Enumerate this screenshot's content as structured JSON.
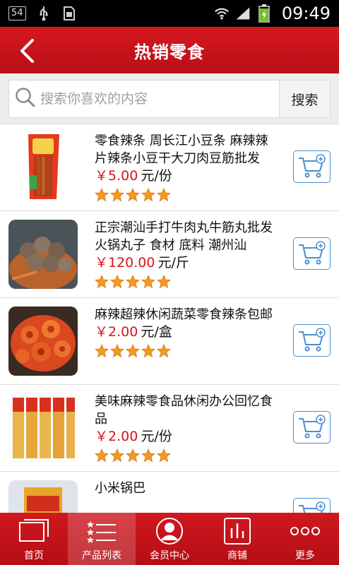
{
  "status_bar": {
    "notification_count": "54",
    "time": "09:49"
  },
  "header": {
    "title": "热销零食"
  },
  "search": {
    "placeholder": "搜索你喜欢的内容",
    "button_label": "搜索"
  },
  "products": [
    {
      "name": "零食辣条 周长江小豆条 麻辣辣片辣条小豆干大刀肉豆筋批发",
      "price": "￥5.00",
      "unit": "元/份",
      "rating": 5
    },
    {
      "name": "正宗潮汕手打牛肉丸牛筋丸批发 火锅丸子 食材 底料 潮州汕",
      "price": "￥120.00",
      "unit": "元/斤",
      "rating": 5
    },
    {
      "name": "麻辣超辣休闲蔬菜零食辣条包邮",
      "price": "￥2.00",
      "unit": "元/盒",
      "rating": 5
    },
    {
      "name": "美味麻辣零食品休闲办公回忆食品",
      "price": "￥2.00",
      "unit": "元/份",
      "rating": 5
    },
    {
      "name": "小米锅巴",
      "price": "",
      "unit": "",
      "rating": 0
    }
  ],
  "tabbar": {
    "active": "products",
    "tabs": [
      {
        "key": "home",
        "label": "首页"
      },
      {
        "key": "products",
        "label": "产品列表"
      },
      {
        "key": "member",
        "label": "会员中心"
      },
      {
        "key": "shop",
        "label": "商铺"
      },
      {
        "key": "more",
        "label": "更多"
      }
    ]
  },
  "colors": {
    "brand_red": "#c8141c",
    "price_red": "#d8141c",
    "cart_blue": "#4a8fd0",
    "star_orange": "#f39a1e"
  }
}
